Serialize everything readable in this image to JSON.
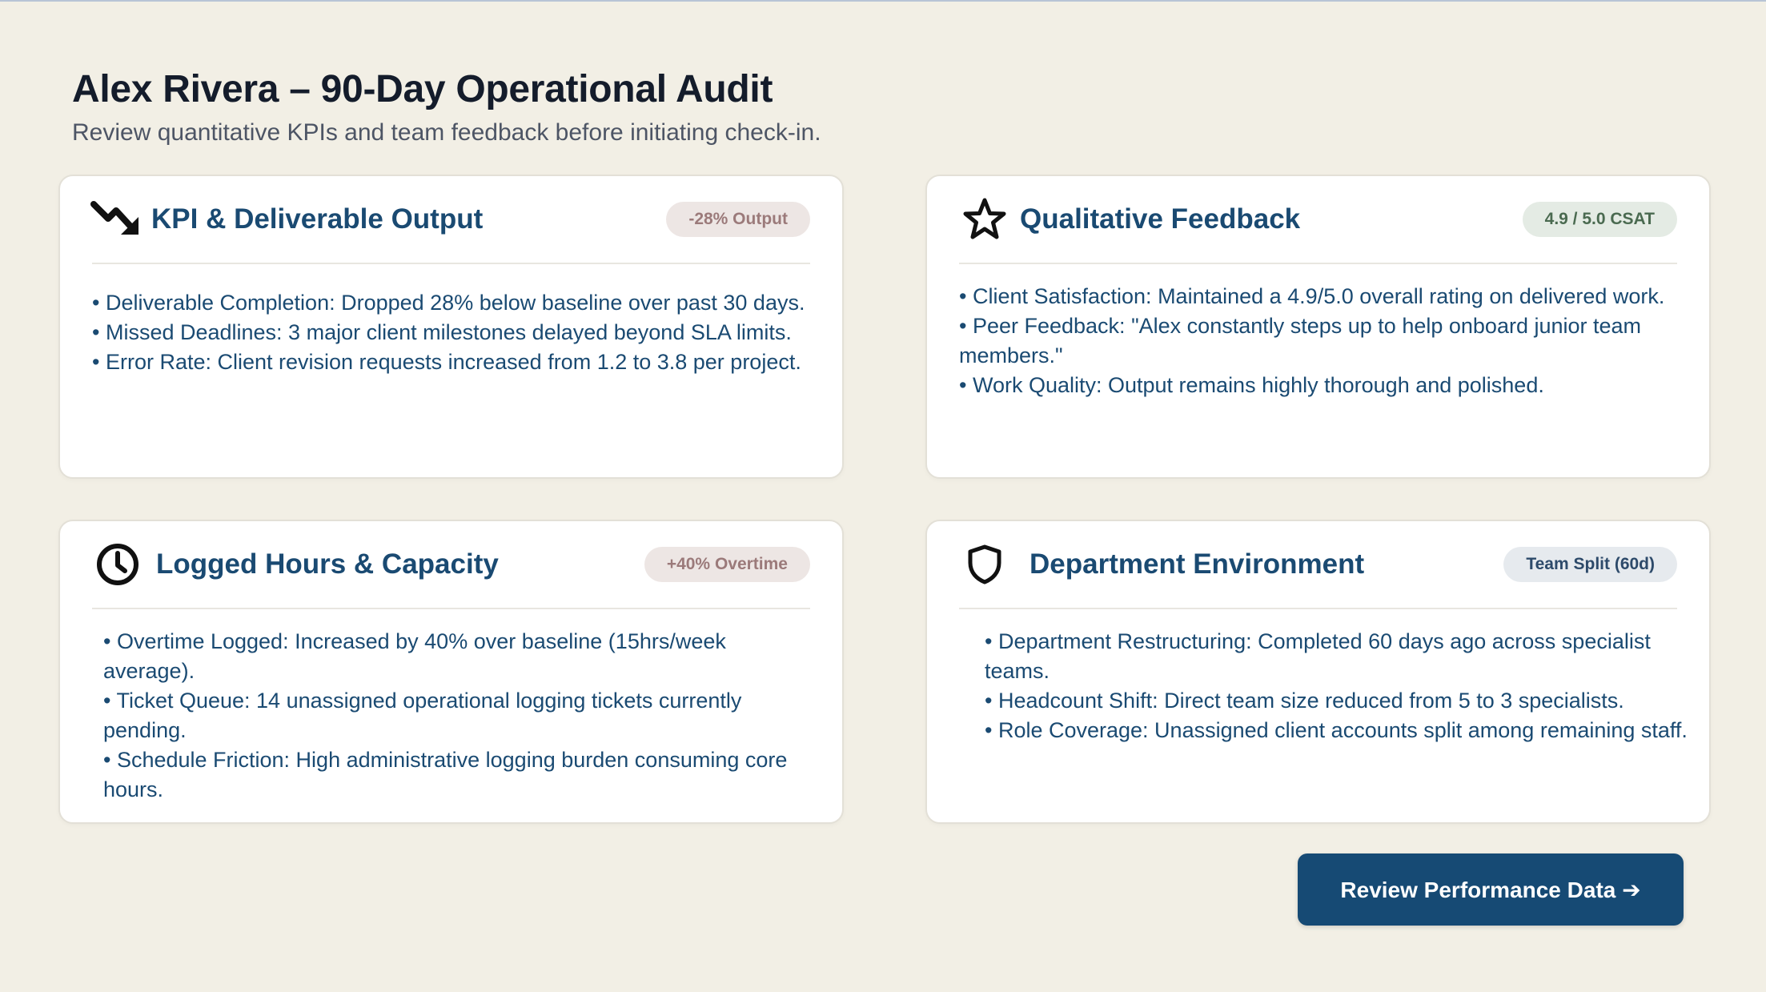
{
  "header": {
    "title": "Alex Rivera – 90-Day Operational Audit",
    "subtitle": "Review quantitative KPIs and team feedback before initiating check-in."
  },
  "cards": [
    {
      "title": "KPI & Deliverable Output",
      "icon": "trending-down-icon",
      "badge": "-28% Output",
      "bullets": [
        "• Deliverable Completion: Dropped 28% below baseline over past 30 days.",
        "• Missed Deadlines: 3 major client milestones delayed beyond SLA limits.",
        "• Error Rate: Client revision requests increased from 1.2 to 3.8 per project."
      ]
    },
    {
      "title": "Qualitative Feedback",
      "icon": "star-icon",
      "badge": "4.9 / 5.0 CSAT",
      "bullets": [
        "• Client Satisfaction: Maintained a 4.9/5.0 overall rating on delivered work.",
        "• Peer Feedback: \"Alex constantly steps up to help onboard junior team members.\"",
        "• Work Quality: Output remains highly thorough and polished."
      ]
    },
    {
      "title": "Logged Hours & Capacity",
      "icon": "clock-icon",
      "badge": "+40% Overtime",
      "bullets": [
        "• Overtime Logged: Increased by 40% over baseline (15hrs/week average).",
        "• Ticket Queue: 14 unassigned operational logging tickets currently pending.",
        "• Schedule Friction: High administrative logging burden consuming core hours."
      ]
    },
    {
      "title": "Department Environment",
      "icon": "shield-icon",
      "badge": "Team Split (60d)",
      "bullets": [
        "• Department Restructuring: Completed 60 days ago across specialist teams.",
        "• Headcount Shift: Direct team size reduced from 5 to 3 specialists.",
        "• Role Coverage: Unassigned client accounts split among remaining staff."
      ]
    }
  ],
  "cta": {
    "label": "Review Performance Data ➔"
  },
  "colors": {
    "background": "#f2efe5",
    "title_blue": "#1a4a72",
    "button_blue": "#164a74",
    "badge_red_text": "#9b7a7a",
    "badge_green_text": "#4a6a50"
  }
}
